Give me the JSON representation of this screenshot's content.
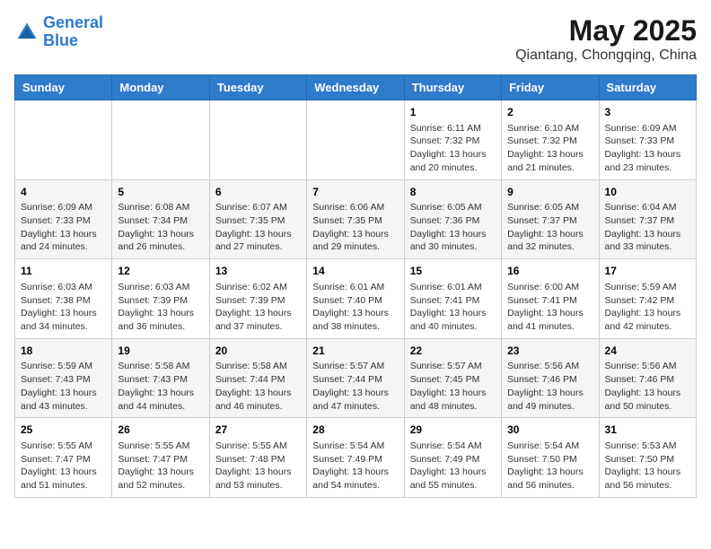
{
  "logo": {
    "line1": "General",
    "line2": "Blue"
  },
  "title": "May 2025",
  "subtitle": "Qiantang, Chongqing, China",
  "weekdays": [
    "Sunday",
    "Monday",
    "Tuesday",
    "Wednesday",
    "Thursday",
    "Friday",
    "Saturday"
  ],
  "weeks": [
    [
      {
        "day": "",
        "info": ""
      },
      {
        "day": "",
        "info": ""
      },
      {
        "day": "",
        "info": ""
      },
      {
        "day": "",
        "info": ""
      },
      {
        "day": "1",
        "info": "Sunrise: 6:11 AM\nSunset: 7:32 PM\nDaylight: 13 hours and 20 minutes."
      },
      {
        "day": "2",
        "info": "Sunrise: 6:10 AM\nSunset: 7:32 PM\nDaylight: 13 hours and 21 minutes."
      },
      {
        "day": "3",
        "info": "Sunrise: 6:09 AM\nSunset: 7:33 PM\nDaylight: 13 hours and 23 minutes."
      }
    ],
    [
      {
        "day": "4",
        "info": "Sunrise: 6:09 AM\nSunset: 7:33 PM\nDaylight: 13 hours and 24 minutes."
      },
      {
        "day": "5",
        "info": "Sunrise: 6:08 AM\nSunset: 7:34 PM\nDaylight: 13 hours and 26 minutes."
      },
      {
        "day": "6",
        "info": "Sunrise: 6:07 AM\nSunset: 7:35 PM\nDaylight: 13 hours and 27 minutes."
      },
      {
        "day": "7",
        "info": "Sunrise: 6:06 AM\nSunset: 7:35 PM\nDaylight: 13 hours and 29 minutes."
      },
      {
        "day": "8",
        "info": "Sunrise: 6:05 AM\nSunset: 7:36 PM\nDaylight: 13 hours and 30 minutes."
      },
      {
        "day": "9",
        "info": "Sunrise: 6:05 AM\nSunset: 7:37 PM\nDaylight: 13 hours and 32 minutes."
      },
      {
        "day": "10",
        "info": "Sunrise: 6:04 AM\nSunset: 7:37 PM\nDaylight: 13 hours and 33 minutes."
      }
    ],
    [
      {
        "day": "11",
        "info": "Sunrise: 6:03 AM\nSunset: 7:38 PM\nDaylight: 13 hours and 34 minutes."
      },
      {
        "day": "12",
        "info": "Sunrise: 6:03 AM\nSunset: 7:39 PM\nDaylight: 13 hours and 36 minutes."
      },
      {
        "day": "13",
        "info": "Sunrise: 6:02 AM\nSunset: 7:39 PM\nDaylight: 13 hours and 37 minutes."
      },
      {
        "day": "14",
        "info": "Sunrise: 6:01 AM\nSunset: 7:40 PM\nDaylight: 13 hours and 38 minutes."
      },
      {
        "day": "15",
        "info": "Sunrise: 6:01 AM\nSunset: 7:41 PM\nDaylight: 13 hours and 40 minutes."
      },
      {
        "day": "16",
        "info": "Sunrise: 6:00 AM\nSunset: 7:41 PM\nDaylight: 13 hours and 41 minutes."
      },
      {
        "day": "17",
        "info": "Sunrise: 5:59 AM\nSunset: 7:42 PM\nDaylight: 13 hours and 42 minutes."
      }
    ],
    [
      {
        "day": "18",
        "info": "Sunrise: 5:59 AM\nSunset: 7:43 PM\nDaylight: 13 hours and 43 minutes."
      },
      {
        "day": "19",
        "info": "Sunrise: 5:58 AM\nSunset: 7:43 PM\nDaylight: 13 hours and 44 minutes."
      },
      {
        "day": "20",
        "info": "Sunrise: 5:58 AM\nSunset: 7:44 PM\nDaylight: 13 hours and 46 minutes."
      },
      {
        "day": "21",
        "info": "Sunrise: 5:57 AM\nSunset: 7:44 PM\nDaylight: 13 hours and 47 minutes."
      },
      {
        "day": "22",
        "info": "Sunrise: 5:57 AM\nSunset: 7:45 PM\nDaylight: 13 hours and 48 minutes."
      },
      {
        "day": "23",
        "info": "Sunrise: 5:56 AM\nSunset: 7:46 PM\nDaylight: 13 hours and 49 minutes."
      },
      {
        "day": "24",
        "info": "Sunrise: 5:56 AM\nSunset: 7:46 PM\nDaylight: 13 hours and 50 minutes."
      }
    ],
    [
      {
        "day": "25",
        "info": "Sunrise: 5:55 AM\nSunset: 7:47 PM\nDaylight: 13 hours and 51 minutes."
      },
      {
        "day": "26",
        "info": "Sunrise: 5:55 AM\nSunset: 7:47 PM\nDaylight: 13 hours and 52 minutes."
      },
      {
        "day": "27",
        "info": "Sunrise: 5:55 AM\nSunset: 7:48 PM\nDaylight: 13 hours and 53 minutes."
      },
      {
        "day": "28",
        "info": "Sunrise: 5:54 AM\nSunset: 7:49 PM\nDaylight: 13 hours and 54 minutes."
      },
      {
        "day": "29",
        "info": "Sunrise: 5:54 AM\nSunset: 7:49 PM\nDaylight: 13 hours and 55 minutes."
      },
      {
        "day": "30",
        "info": "Sunrise: 5:54 AM\nSunset: 7:50 PM\nDaylight: 13 hours and 56 minutes."
      },
      {
        "day": "31",
        "info": "Sunrise: 5:53 AM\nSunset: 7:50 PM\nDaylight: 13 hours and 56 minutes."
      }
    ]
  ]
}
